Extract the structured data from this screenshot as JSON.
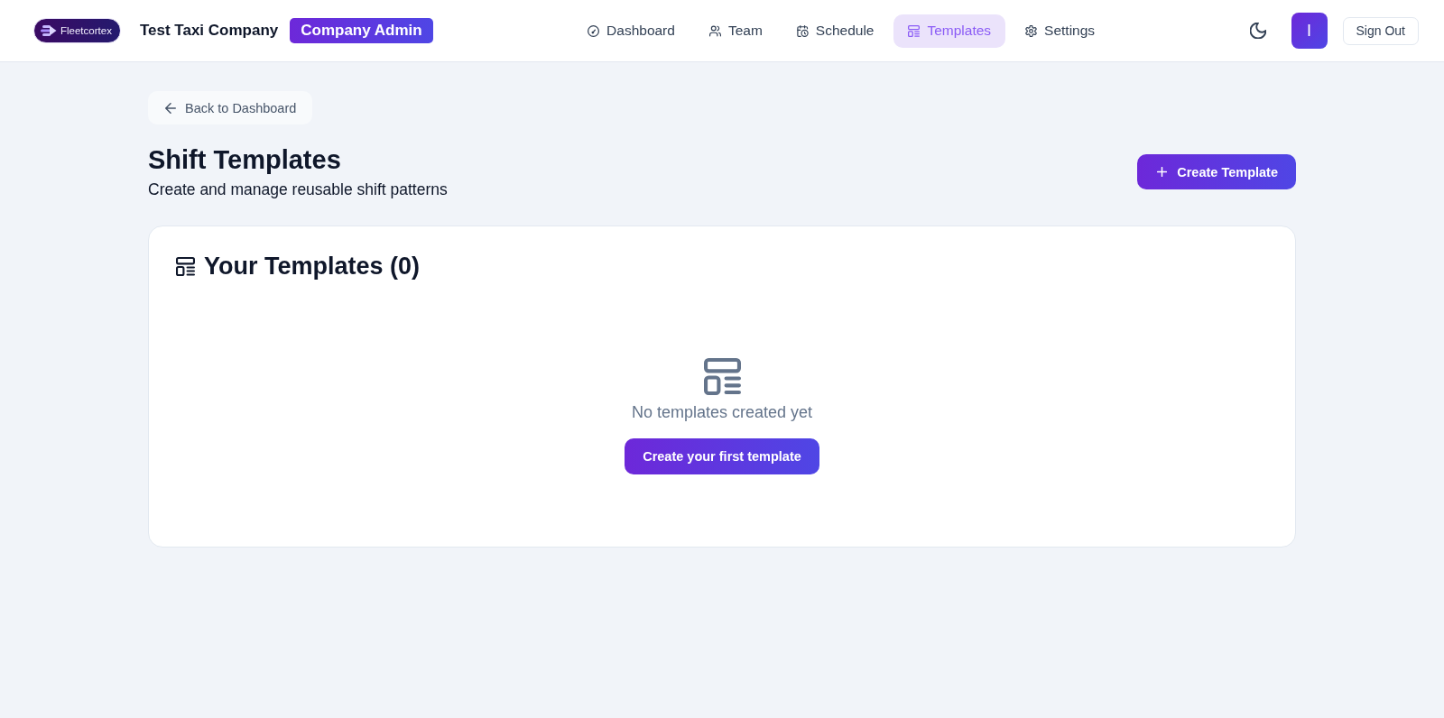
{
  "header": {
    "logo": {
      "text": "Fleetcortex"
    },
    "company": "Test Taxi Company",
    "role_badge": "Company Admin",
    "nav": [
      {
        "label": "Dashboard",
        "kind": "dashboard",
        "selected": false
      },
      {
        "label": "Team",
        "kind": "team",
        "selected": false
      },
      {
        "label": "Schedule",
        "kind": "schedule",
        "selected": false
      },
      {
        "label": "Templates",
        "kind": "templates",
        "selected": true
      },
      {
        "label": "Settings",
        "kind": "settings",
        "selected": false
      }
    ],
    "avatar": {
      "initial": "I"
    },
    "sign_out": "Sign Out"
  },
  "back_link": "Back to Dashboard",
  "page": {
    "title": "Shift Templates",
    "subtitle": "Create and manage reusable shift patterns",
    "create_button": "Create Template"
  },
  "card": {
    "title": "Your Templates (0)",
    "empty_state": {
      "message": "No templates created yet",
      "button": "Create your first template"
    }
  }
}
